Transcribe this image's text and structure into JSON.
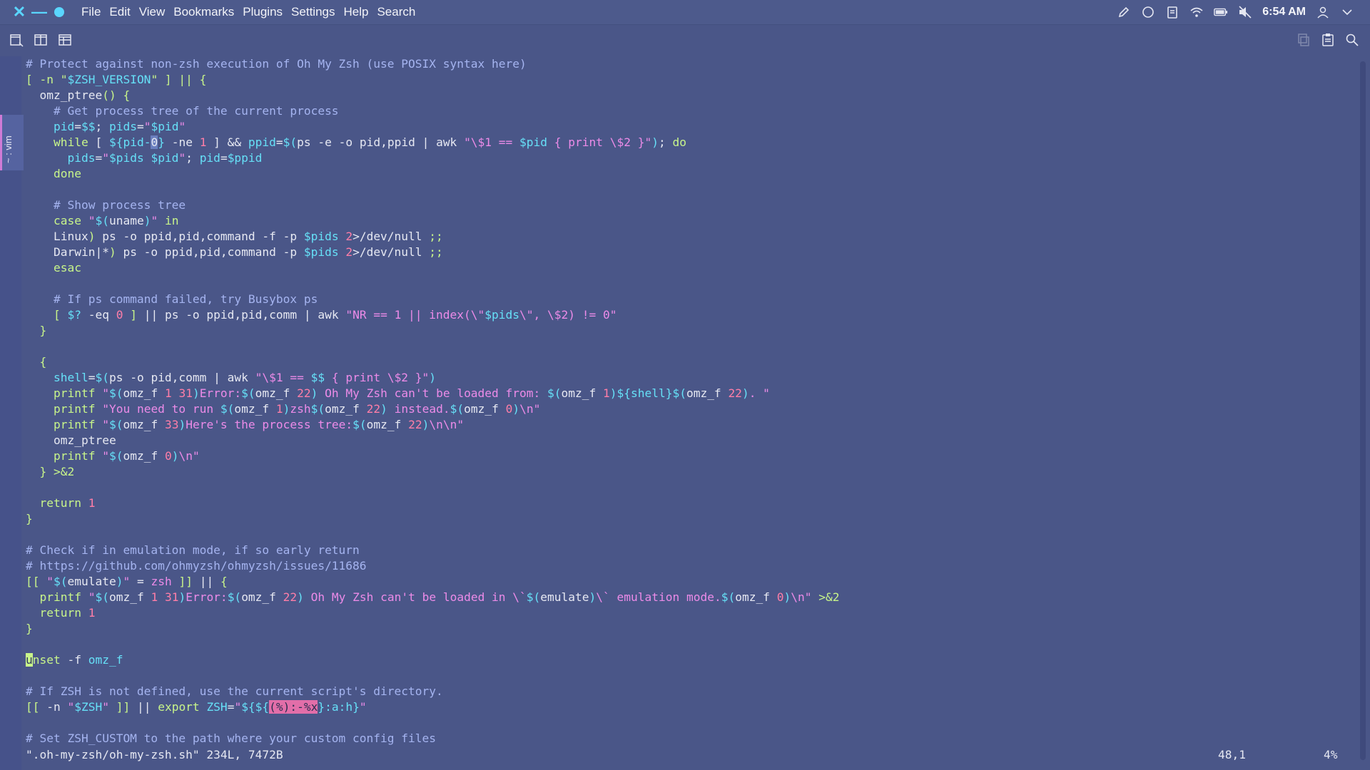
{
  "menubar": {
    "items": [
      "File",
      "Edit",
      "View",
      "Bookmarks",
      "Plugins",
      "Settings",
      "Help",
      "Search"
    ],
    "clock": "6:54 AM"
  },
  "sidetab": {
    "label": "~ : vim"
  },
  "editor": {
    "lines": [
      "# Protect against non-zsh execution of Oh My Zsh (use POSIX syntax here)",
      "[ -n \"$ZSH_VERSION\" ] || {",
      "  omz_ptree() {",
      "    # Get process tree of the current process",
      "    pid=$$; pids=\"$pid\"",
      "    while [ ${pid-0} -ne 1 ] && ppid=$(ps -e -o pid,ppid | awk \"\\$1 == $pid { print \\$2 }\"); do",
      "      pids=\"$pids $pid\"; pid=$ppid",
      "    done",
      "",
      "    # Show process tree",
      "    case \"$(uname)\" in",
      "    Linux) ps -o ppid,pid,command -f -p $pids 2>/dev/null ;;",
      "    Darwin|*) ps -o ppid,pid,command -p $pids 2>/dev/null ;;",
      "    esac",
      "",
      "    # If ps command failed, try Busybox ps",
      "    [ $? -eq 0 ] || ps -o ppid,pid,comm | awk \"NR == 1 || index(\\\"$pids\\\", \\$2) != 0\"",
      "  }",
      "",
      "  {",
      "    shell=$(ps -o pid,comm | awk \"\\$1 == $$ { print \\$2 }\")",
      "    printf \"$(omz_f 1 31)Error:$(omz_f 22) Oh My Zsh can't be loaded from: $(omz_f 1)${shell}$(omz_f 22). \"",
      "    printf \"You need to run $(omz_f 1)zsh$(omz_f 22) instead.$(omz_f 0)\\n\"",
      "    printf \"$(omz_f 33)Here's the process tree:$(omz_f 22)\\n\\n\"",
      "    omz_ptree",
      "    printf \"$(omz_f 0)\\n\"",
      "  } >&2",
      "",
      "  return 1",
      "}",
      "",
      "# Check if in emulation mode, if so early return",
      "# https://github.com/ohmyzsh/ohmyzsh/issues/11686",
      "[[ \"$(emulate)\" = zsh ]] || {",
      "  printf \"$(omz_f 1 31)Error:$(omz_f 22) Oh My Zsh can't be loaded in \\`$(emulate)\\` emulation mode.$(omz_f 0)\\n\" >&2",
      "  return 1",
      "}",
      "",
      "unset -f omz_f",
      "",
      "# If ZSH is not defined, use the current script's directory.",
      "[[ -n \"$ZSH\" ]] || export ZSH=\"${${(%):-%x}:a:h}\"",
      "",
      "# Set ZSH_CUSTOM to the path where your custom config files"
    ]
  },
  "statusbar": {
    "file": "\".oh-my-zsh/oh-my-zsh.sh\" 234L, 7472B",
    "position": "48,1",
    "percent": "4%"
  },
  "colors": {
    "background": "#4a5688",
    "comment": "#a5b4f0",
    "keyword": "#c8f58a",
    "string": "#ec8be8",
    "variable": "#66e0f7",
    "number": "#ff7ea8"
  }
}
